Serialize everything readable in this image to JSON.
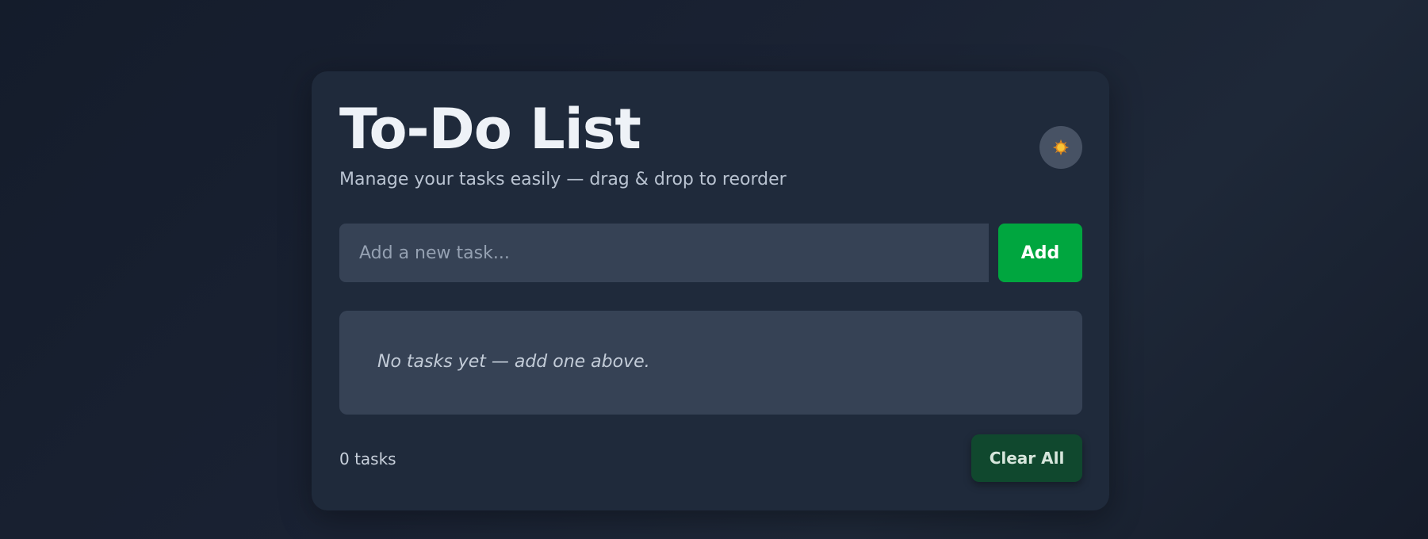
{
  "header": {
    "title": "To-Do List",
    "subtitle": "Manage your tasks easily — drag & drop to reorder",
    "theme_toggle_icon": "sun-icon"
  },
  "input": {
    "placeholder": "Add a new task...",
    "value": ""
  },
  "add_button": {
    "label": "Add"
  },
  "task_list": {
    "items": [],
    "empty_message": "No tasks yet — add one above."
  },
  "footer": {
    "count_text": "0 tasks",
    "clear_label": "Clear All"
  },
  "colors": {
    "accent_green": "#00a63f",
    "clear_button": "#10482e",
    "card": "#1f2a3b",
    "input_bg": "#364255"
  }
}
